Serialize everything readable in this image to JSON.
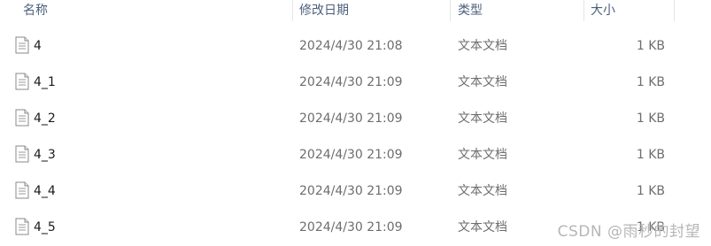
{
  "columns": {
    "name": "名称",
    "date_modified": "修改日期",
    "type": "类型",
    "size": "大小"
  },
  "files": [
    {
      "name": "4",
      "date": "2024/4/30 21:08",
      "type": "文本文档",
      "size": "1 KB",
      "icon": "text-file-icon"
    },
    {
      "name": "4_1",
      "date": "2024/4/30 21:09",
      "type": "文本文档",
      "size": "1 KB",
      "icon": "text-file-icon"
    },
    {
      "name": "4_2",
      "date": "2024/4/30 21:09",
      "type": "文本文档",
      "size": "1 KB",
      "icon": "text-file-icon"
    },
    {
      "name": "4_3",
      "date": "2024/4/30 21:09",
      "type": "文本文档",
      "size": "1 KB",
      "icon": "text-file-icon"
    },
    {
      "name": "4_4",
      "date": "2024/4/30 21:09",
      "type": "文本文档",
      "size": "1 KB",
      "icon": "text-file-icon"
    },
    {
      "name": "4_5",
      "date": "2024/4/30 21:09",
      "type": "文本文档",
      "size": "1 KB",
      "icon": "text-file-icon"
    }
  ],
  "watermark": "CSDN @雨秒的封望",
  "colors": {
    "header_text": "#4c607a",
    "row_text": "#1a1a1a",
    "meta_text": "#6d6d6d"
  }
}
